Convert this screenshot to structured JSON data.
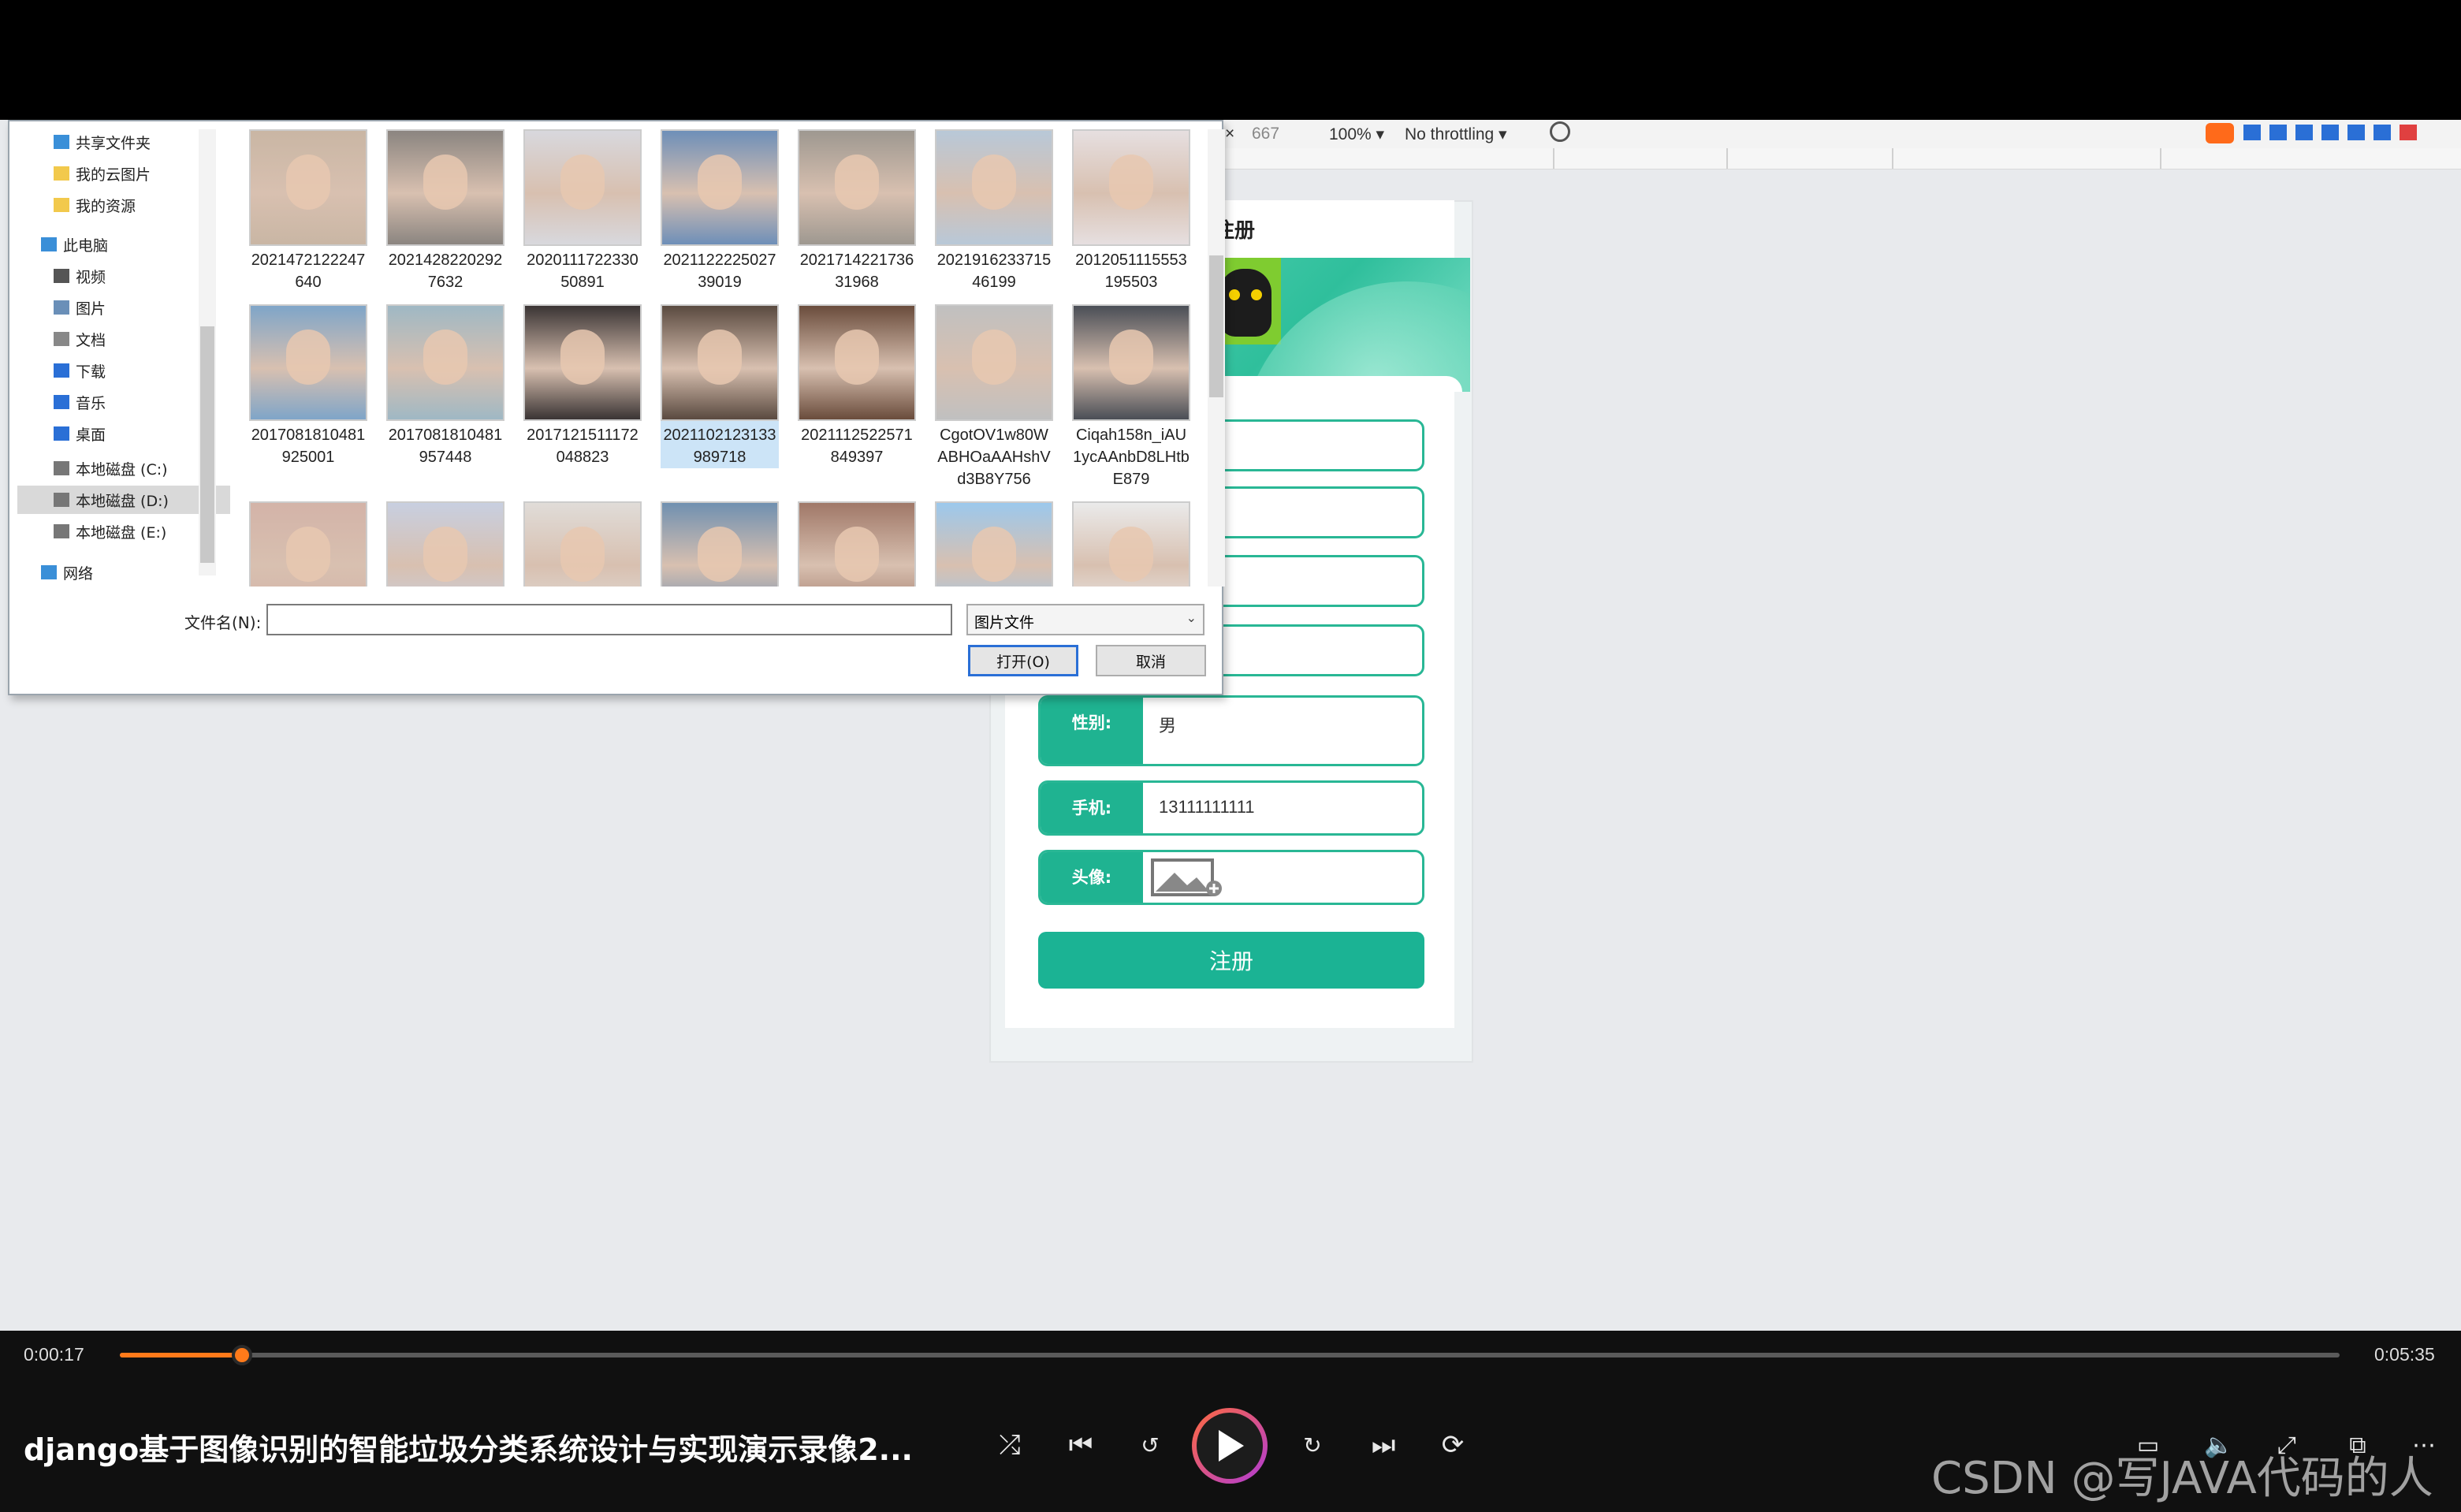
{
  "devtools": {
    "close_glyph": "×",
    "height_value": "667",
    "zoom": "100% ▾",
    "throttling": "No throttling ▾"
  },
  "register": {
    "title": "注册",
    "fields": [
      {
        "label": "性别:",
        "value": "男"
      },
      {
        "label": "手机:",
        "value": "13111111111"
      },
      {
        "label": "头像:",
        "value": ""
      }
    ],
    "submit_label": "注册"
  },
  "file_dialog": {
    "sidebar": [
      {
        "label": "共享文件夹",
        "icon": "share-folder-icon"
      },
      {
        "label": "我的云图片",
        "icon": "folder-icon"
      },
      {
        "label": "我的资源",
        "icon": "folder-icon"
      },
      {
        "label": "此电脑",
        "icon": "computer-icon"
      },
      {
        "label": "视频",
        "icon": "video-icon"
      },
      {
        "label": "图片",
        "icon": "pictures-icon"
      },
      {
        "label": "文档",
        "icon": "documents-icon"
      },
      {
        "label": "下载",
        "icon": "download-icon"
      },
      {
        "label": "音乐",
        "icon": "music-icon"
      },
      {
        "label": "桌面",
        "icon": "desktop-icon"
      },
      {
        "label": "本地磁盘 (C:)",
        "icon": "drive-icon"
      },
      {
        "label": "本地磁盘 (D:)",
        "icon": "drive-icon"
      },
      {
        "label": "本地磁盘 (E:)",
        "icon": "drive-icon"
      },
      {
        "label": "网络",
        "icon": "network-icon"
      }
    ],
    "thumbnails_row1": [
      {
        "caption": "2021472122247640",
        "color": "#c9b6a4"
      },
      {
        "caption": "20214282202927632",
        "color": "#8b8580"
      },
      {
        "caption": "202011172233050891",
        "color": "#d8d8dd"
      },
      {
        "caption": "202112222502739019",
        "color": "#6e8fb8"
      },
      {
        "caption": "202171422173631968",
        "color": "#9e9890"
      },
      {
        "caption": "202191623371546199",
        "color": "#b8c8d8"
      },
      {
        "caption": "2012051115553195503",
        "color": "#e6dfe0"
      }
    ],
    "thumbnails_row2": [
      {
        "caption": "2017081810481925001",
        "color": "#7fa5c8"
      },
      {
        "caption": "2017081810481957448",
        "color": "#9fb8c4"
      },
      {
        "caption": "2017121511172048823",
        "color": "#3a3434"
      },
      {
        "caption": "2021102123133989718",
        "color": "#5a4a40"
      },
      {
        "caption": "2021112522571849397",
        "color": "#6a4c3c"
      },
      {
        "caption": "CgotOV1w80WABHOaAAHshVd3B8Y756",
        "color": "#c0c0c0"
      },
      {
        "caption": "Ciqah158n_iAU1ycAAnbD8LHtbE879",
        "color": "#4a4e56"
      }
    ],
    "thumbnails_row3": [
      {
        "color": "#d3b3a8"
      },
      {
        "color": "#c8cfe0"
      },
      {
        "color": "#e0dcd8"
      },
      {
        "color": "#7090b0"
      },
      {
        "color": "#a07868"
      },
      {
        "color": "#9cc8ec"
      },
      {
        "color": "#eaeaea"
      }
    ],
    "filename_label": "文件名(N):",
    "filename_value": "",
    "filetype": "图片文件",
    "open_label": "打开(O)",
    "cancel_label": "取消"
  },
  "player": {
    "current_time": "0:00:17",
    "total_time": "0:05:35",
    "progress": 0.055,
    "title": "django基于图像识别的智能垃圾分类系统设计与实现演示录像2...",
    "watermark": "CSDN @写JAVA代码的人"
  }
}
